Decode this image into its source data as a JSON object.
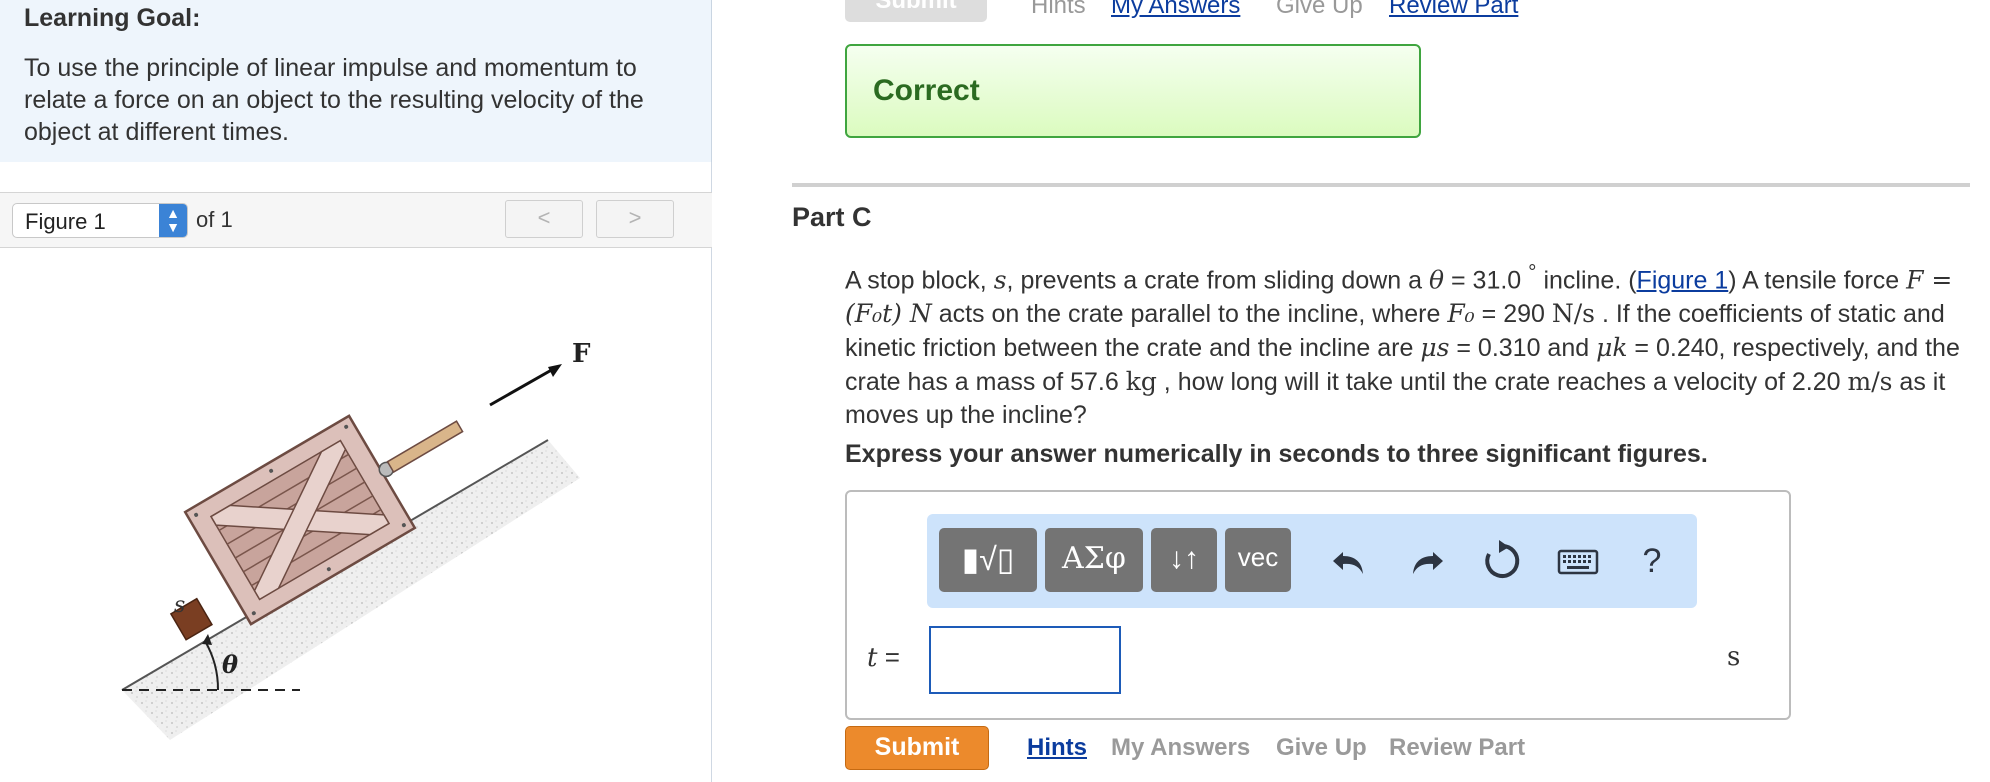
{
  "learning_goal": {
    "title": "Learning Goal:",
    "text": "To use the principle of linear impulse and momentum to relate a force on an object to the resulting velocity of the object at different times."
  },
  "figure_nav": {
    "selected": "Figure 1",
    "of_label": "of 1",
    "prev_icon": "chevron-left-icon",
    "next_icon": "chevron-right-icon"
  },
  "figure": {
    "force_label": "F",
    "block_label": "s",
    "angle_label": "θ"
  },
  "top_links": {
    "submit": "Submit",
    "hints": "Hints",
    "my_answers": "My Answers",
    "give_up": "Give Up",
    "review_part": "Review Part"
  },
  "feedback": {
    "text": "Correct",
    "color": "#2b6b21"
  },
  "part": {
    "title": "Part C",
    "problem": {
      "s1": "A stop block, ",
      "s_var": "s",
      "s2": ", prevents a crate from sliding down a ",
      "theta": "θ",
      "s3": " = 31.0 ",
      "deg": "°",
      "s4": " incline. (",
      "figure_link": "Figure 1",
      "s5": ") A tensile force ",
      "f_expr": "F = (F₀t) N",
      "s6": " acts on the crate parallel to the incline, where ",
      "f0": "F₀",
      "s7": " = 290 ",
      "f0_unit": "N/s",
      "s8": " . If the coefficients of static and kinetic friction between the crate and the incline are ",
      "mu_s": "μs",
      "s9": " = 0.310 and ",
      "mu_k": "μk",
      "s10": " = 0.240, respectively, and the crate has a mass of 57.6 ",
      "kg": "kg",
      "s11": " , how long will it take until the crate reaches a velocity of 2.20 ",
      "ms": "m/s",
      "s12": " as it moves up the incline?"
    },
    "instruction": "Express your answer numerically in seconds to three significant figures."
  },
  "toolbar": {
    "templates": "▮√▯",
    "greek": "ΑΣφ",
    "arrows": "↓↑",
    "vec": "vec",
    "undo_icon": "undo-icon",
    "redo_icon": "redo-icon",
    "reset_icon": "reset-icon",
    "keyboard_icon": "keyboard-icon",
    "help": "?"
  },
  "answer": {
    "variable": "t",
    "equals": "=",
    "value": "",
    "unit": "s"
  },
  "bottom_bar": {
    "submit": "Submit",
    "hints": "Hints",
    "my_answers": "My Answers",
    "give_up": "Give Up",
    "review_part": "Review Part"
  }
}
